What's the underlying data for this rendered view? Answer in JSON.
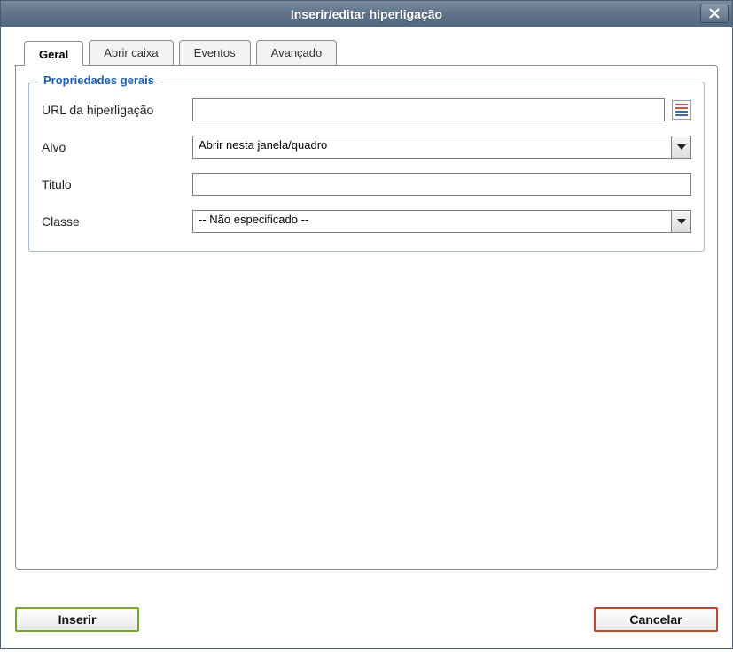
{
  "dialog": {
    "title": "Inserir/editar hiperligação"
  },
  "tabs": {
    "general": "Geral",
    "popup": "Abrir caixa",
    "events": "Eventos",
    "advanced": "Avançado"
  },
  "fieldset": {
    "legend": "Propriedades gerais"
  },
  "form": {
    "url_label": "URL da hiperligação",
    "url_value": "",
    "target_label": "Alvo",
    "target_value": "Abrir nesta janela/quadro",
    "title_label": "Titulo",
    "title_value": "",
    "class_label": "Classe",
    "class_value": "-- Não especificado --"
  },
  "buttons": {
    "insert": "Inserir",
    "cancel": "Cancelar"
  }
}
